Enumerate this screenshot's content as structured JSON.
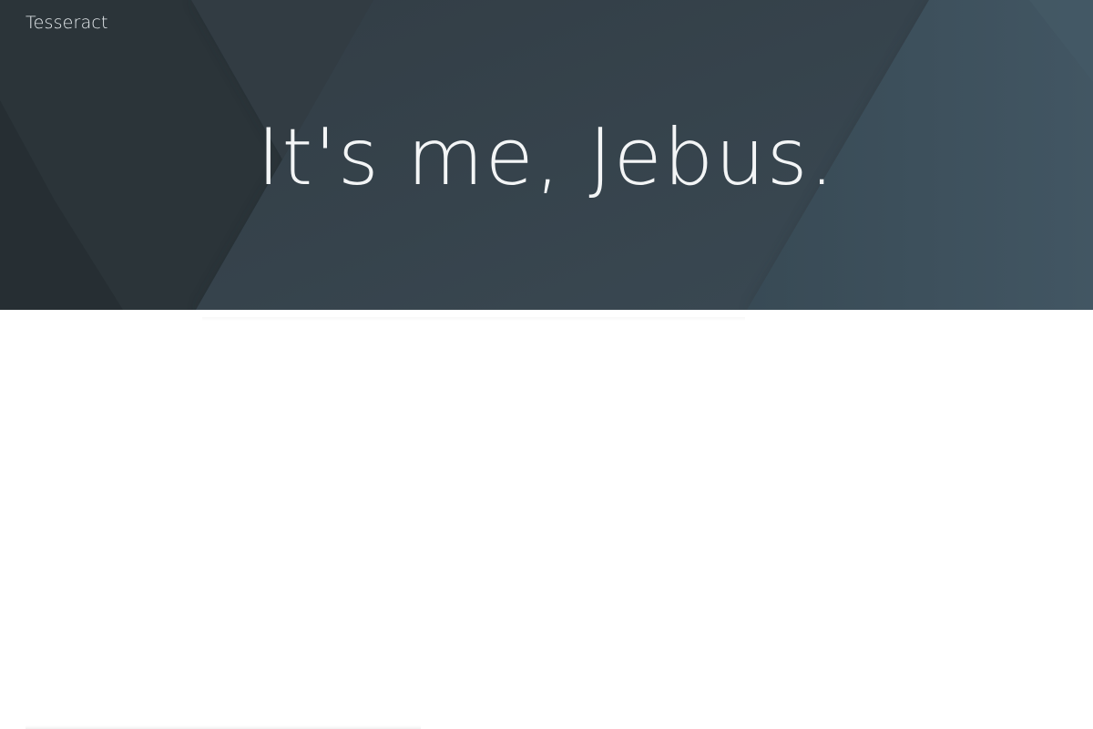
{
  "site": {
    "brand": "Tesseract"
  },
  "hero": {
    "headline": "It's me, Jebus."
  },
  "colors": {
    "hero_base": "#2f3a42",
    "hero_dark": "#283136",
    "hero_light": "#3a4a55",
    "text_light": "#f3f5f6",
    "page_background": "#ffffff"
  }
}
